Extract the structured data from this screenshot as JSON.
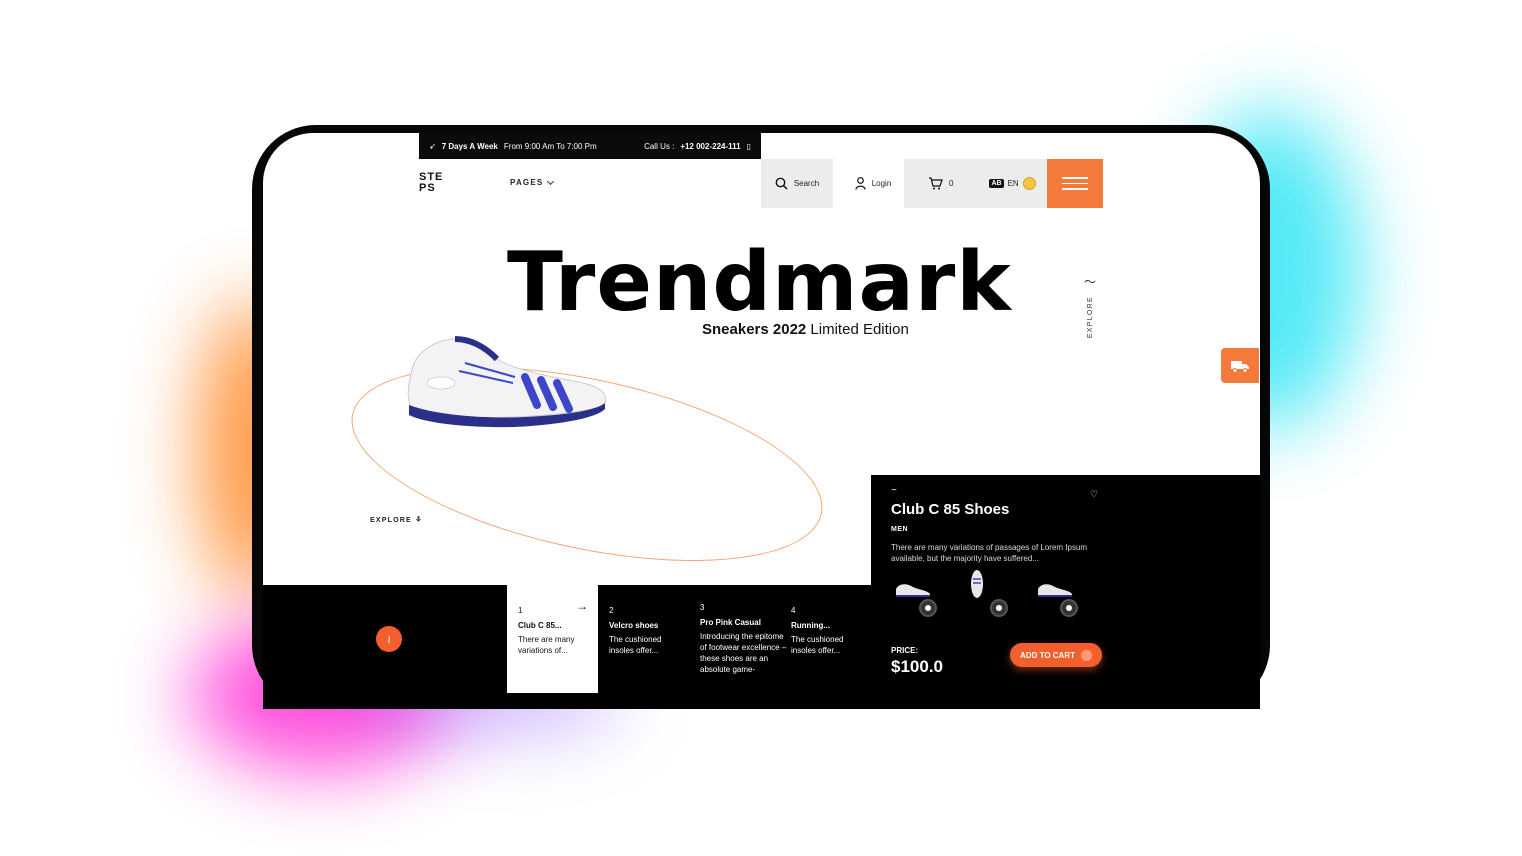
{
  "topbar": {
    "days": "7 Days A Week",
    "hours": "From 9:00 Am To 7:00 Pm",
    "call_label": "Call Us :",
    "phone": "+12 002-224-111"
  },
  "logo": {
    "line1": "STE",
    "line2": "PS"
  },
  "nav": {
    "pages": "PAGES",
    "search": "Search",
    "login": "Login",
    "cart_count": "0",
    "lang_badge": "AB",
    "lang": "EN"
  },
  "hero": {
    "title": "Trendmark",
    "subtitle_bold": "Sneakers 2022",
    "subtitle_rest": " Limited Edition",
    "explore_side": "EXPLORE",
    "explore_left": "EXPLORE"
  },
  "cards": [
    {
      "num": "1",
      "title": "Club C 85...",
      "text": "There are many variations of..."
    },
    {
      "num": "2",
      "title": "Velcro shoes",
      "text": "The cushioned insoles offer..."
    },
    {
      "num": "3",
      "title": "Pro Pink Casual",
      "text": "Introducing the epitome of footwear excellence – these shoes are an absolute game-"
    },
    {
      "num": "4",
      "title": "Running...",
      "text": "The cushioned insoles offer..."
    }
  ],
  "product": {
    "name": "Club C 85 Shoes",
    "category": "MEN",
    "description": "There are many variations of passages of Lorem Ipsum available, but the majority have suffered...",
    "price_label": "PRICE:",
    "price": "$100.0",
    "add_to_cart": "ADD TO CART"
  },
  "colors": {
    "accent": "#f47a3c",
    "dark": "#000000",
    "bg": "#ffffff"
  },
  "icons": [
    "rocket-icon",
    "phone-icon",
    "search-icon",
    "user-icon",
    "cart-icon",
    "globe-icon",
    "hamburger-icon",
    "truck-icon",
    "heart-icon"
  ]
}
